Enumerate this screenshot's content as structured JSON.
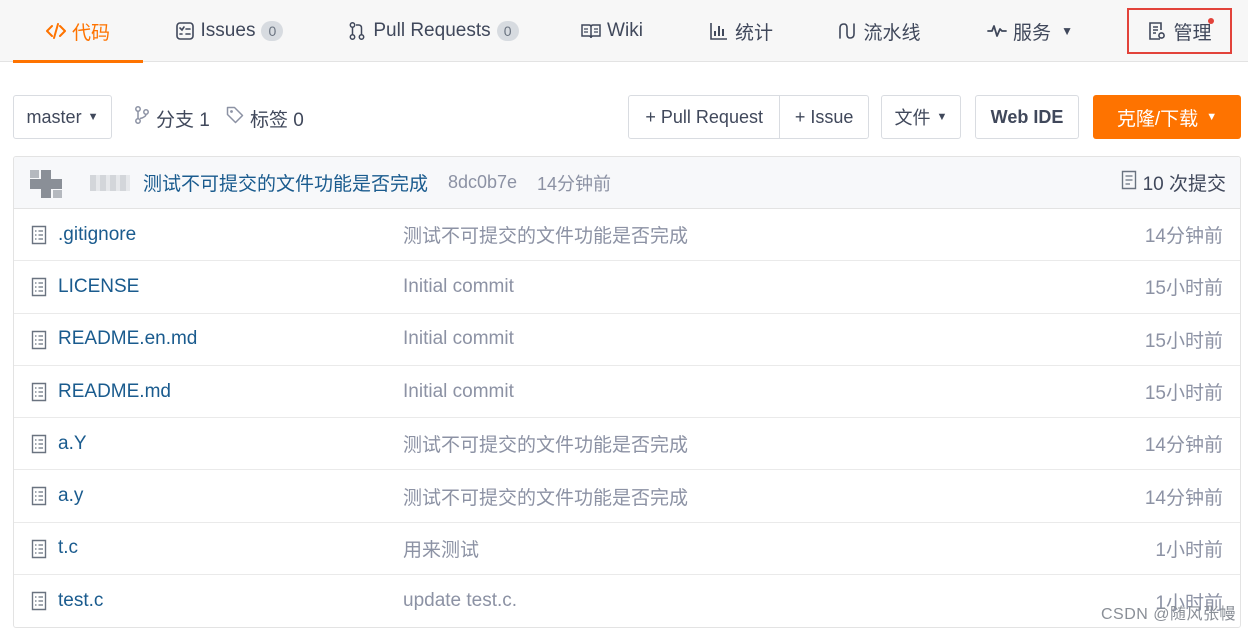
{
  "nav": {
    "code": "代码",
    "issues": "Issues",
    "issues_count": "0",
    "pull_requests": "Pull Requests",
    "pull_requests_count": "0",
    "wiki": "Wiki",
    "stats": "统计",
    "pipeline": "流水线",
    "services": "服务",
    "manage": "管理"
  },
  "toolbar": {
    "branch": "master",
    "branches_label": "分支 1",
    "tags_label": "标签 0",
    "pull_request_btn": "+ Pull Request",
    "issue_btn": "+ Issue",
    "file_btn": "文件",
    "web_ide_btn": "Web IDE",
    "clone_btn": "克隆/下载"
  },
  "latest_commit": {
    "message": "测试不可提交的文件功能是否完成",
    "sha": "8dc0b7e",
    "time": "14分钟前",
    "count_label": "10 次提交"
  },
  "files": [
    {
      "name": ".gitignore",
      "message": "测试不可提交的文件功能是否完成",
      "time": "14分钟前"
    },
    {
      "name": "LICENSE",
      "message": "Initial commit",
      "time": "15小时前"
    },
    {
      "name": "README.en.md",
      "message": "Initial commit",
      "time": "15小时前"
    },
    {
      "name": "README.md",
      "message": "Initial commit",
      "time": "15小时前"
    },
    {
      "name": "a.Y",
      "message": "测试不可提交的文件功能是否完成",
      "time": "14分钟前"
    },
    {
      "name": "a.y",
      "message": "测试不可提交的文件功能是否完成",
      "time": "14分钟前"
    },
    {
      "name": "t.c",
      "message": "用来测试",
      "time": "1小时前"
    },
    {
      "name": "test.c",
      "message": "update test.c.",
      "time": "1小时前"
    }
  ],
  "watermark": "CSDN @随风张幔",
  "colors": {
    "accent": "#fe7300",
    "link": "#1a5b8e",
    "muted": "#8c92a4",
    "highlight_border": "#e2423a"
  },
  "icons": {
    "code": "code-brackets-icon",
    "issues": "issue-list-icon",
    "pull_requests": "pull-request-icon",
    "wiki": "book-icon",
    "stats": "bar-chart-icon",
    "pipeline": "pipeline-icon",
    "services": "pulse-icon",
    "manage": "settings-doc-icon",
    "branch": "branch-icon",
    "tag": "tag-icon",
    "commit_count": "commit-doc-icon",
    "file": "file-icon"
  }
}
